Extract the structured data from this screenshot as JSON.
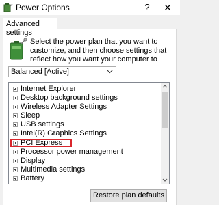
{
  "window": {
    "title": "Power Options",
    "help_label": "?",
    "close_label": "✕",
    "icon": "power-options-icon"
  },
  "tabs": [
    {
      "label": "Advanced settings",
      "selected": true
    }
  ],
  "description": "Select the power plan that you want to customize, and then choose settings that reflect how you want your computer to manage power.",
  "plan_select": {
    "value": "Balanced [Active]"
  },
  "settings_tree": {
    "items": [
      {
        "label": "Internet Explorer"
      },
      {
        "label": "Desktop background settings"
      },
      {
        "label": "Wireless Adapter Settings"
      },
      {
        "label": "Sleep"
      },
      {
        "label": "USB settings"
      },
      {
        "label": "Intel(R) Graphics Settings"
      },
      {
        "label": "PCI Express",
        "highlighted": true
      },
      {
        "label": "Processor power management"
      },
      {
        "label": "Display"
      },
      {
        "label": "Multimedia settings"
      },
      {
        "label": "Battery"
      }
    ],
    "highlight_color": "#d9262c"
  },
  "buttons": {
    "restore_defaults": "Restore plan defaults"
  }
}
